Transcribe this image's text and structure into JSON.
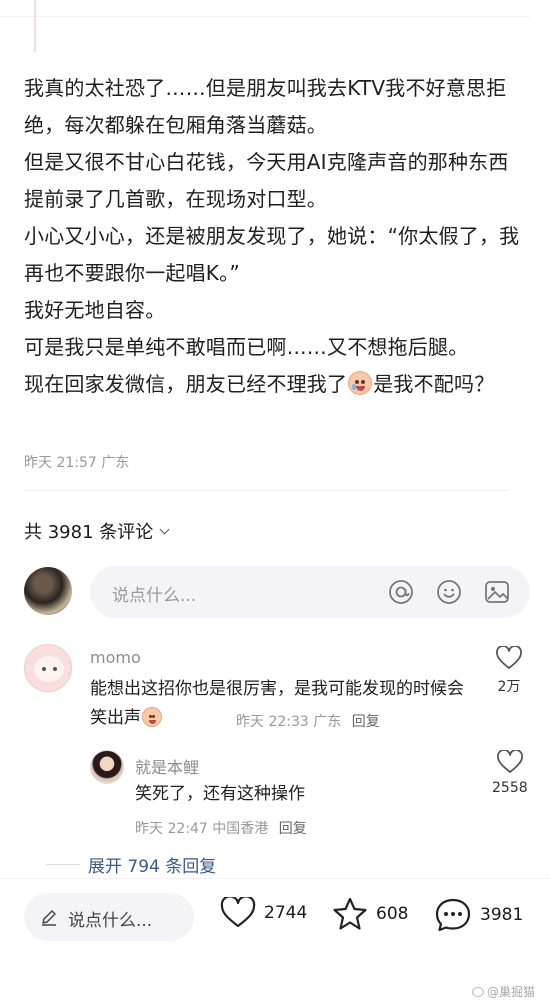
{
  "post": {
    "lines": [
      "我真的太社恐了……但是朋友叫我去KTV我不好意思拒绝，每次都躲在包厢角落当蘑菇。",
      "但是又很不甘心白花钱，今天用AI克隆声音的那种东西提前录了几首歌，在现场对口型。",
      "小心又小心，还是被朋友发现了，她说：“你太假了，我再也不要跟你一起唱K。”",
      "我好无地自容。",
      "可是我只是单纯不敢唱而已啊……又不想拖后腿。"
    ],
    "last_line_before_emoji": "现在回家发微信，朋友已经不理我了",
    "last_line_after_emoji": "是我不配吗？",
    "emoji": "crying-face-emoji",
    "meta": "昨天 21:57 广东"
  },
  "comments_header": {
    "label": "共 3981 条评论"
  },
  "composer": {
    "placeholder": "说点什么..."
  },
  "comments": [
    {
      "name": "momo",
      "text_before_emoji": "能想出这招你也是很厉害，是我可能发现的时候会笑出声",
      "meta_time": "昨天 22:33",
      "meta_loc": "广东",
      "reply": "回复",
      "likes": "2万"
    },
    {
      "name": "就是本鲤",
      "text": "笑死了，还有这种操作",
      "meta_time": "昨天 22:47",
      "meta_loc": "中国香港",
      "reply": "回复",
      "likes": "2558"
    }
  ],
  "expand_label": "展开 794 条回复",
  "bottom_bar": {
    "placeholder": "说点什么...",
    "likes": "2744",
    "favorites": "608",
    "comments": "3981"
  },
  "watermark": "@巢掘猫",
  "colors": {
    "link": "#3a5a88",
    "muted": "#999999",
    "input_bg": "#f4f4f6"
  }
}
